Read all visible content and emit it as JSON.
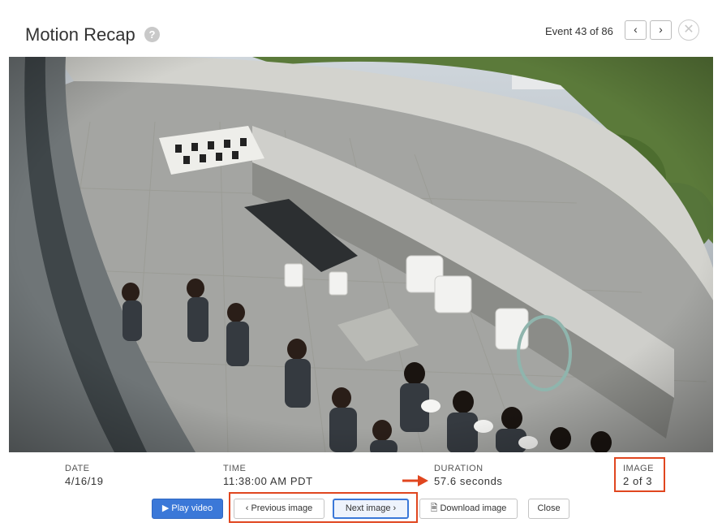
{
  "header": {
    "title": "Motion Recap",
    "help_icon": "question-circle-icon",
    "event_counter": "Event 43 of 86",
    "prev_icon": "chevron-left-icon",
    "next_icon": "chevron-right-icon",
    "close_icon": "close-circle-icon"
  },
  "details": {
    "date_label": "DATE",
    "date_value": "4/16/19",
    "time_label": "TIME",
    "time_value": "11:38:00 AM PDT",
    "duration_label": "DURATION",
    "duration_value": "57.6 seconds",
    "image_label": "IMAGE",
    "image_value": "2 of 3"
  },
  "buttons": {
    "play_video": "Play video",
    "previous_image": "Previous image",
    "next_image": "Next image",
    "download_image": "Download image",
    "close": "Close"
  },
  "colors": {
    "annotation": "#e0461f",
    "primary": "#3b78d8"
  }
}
